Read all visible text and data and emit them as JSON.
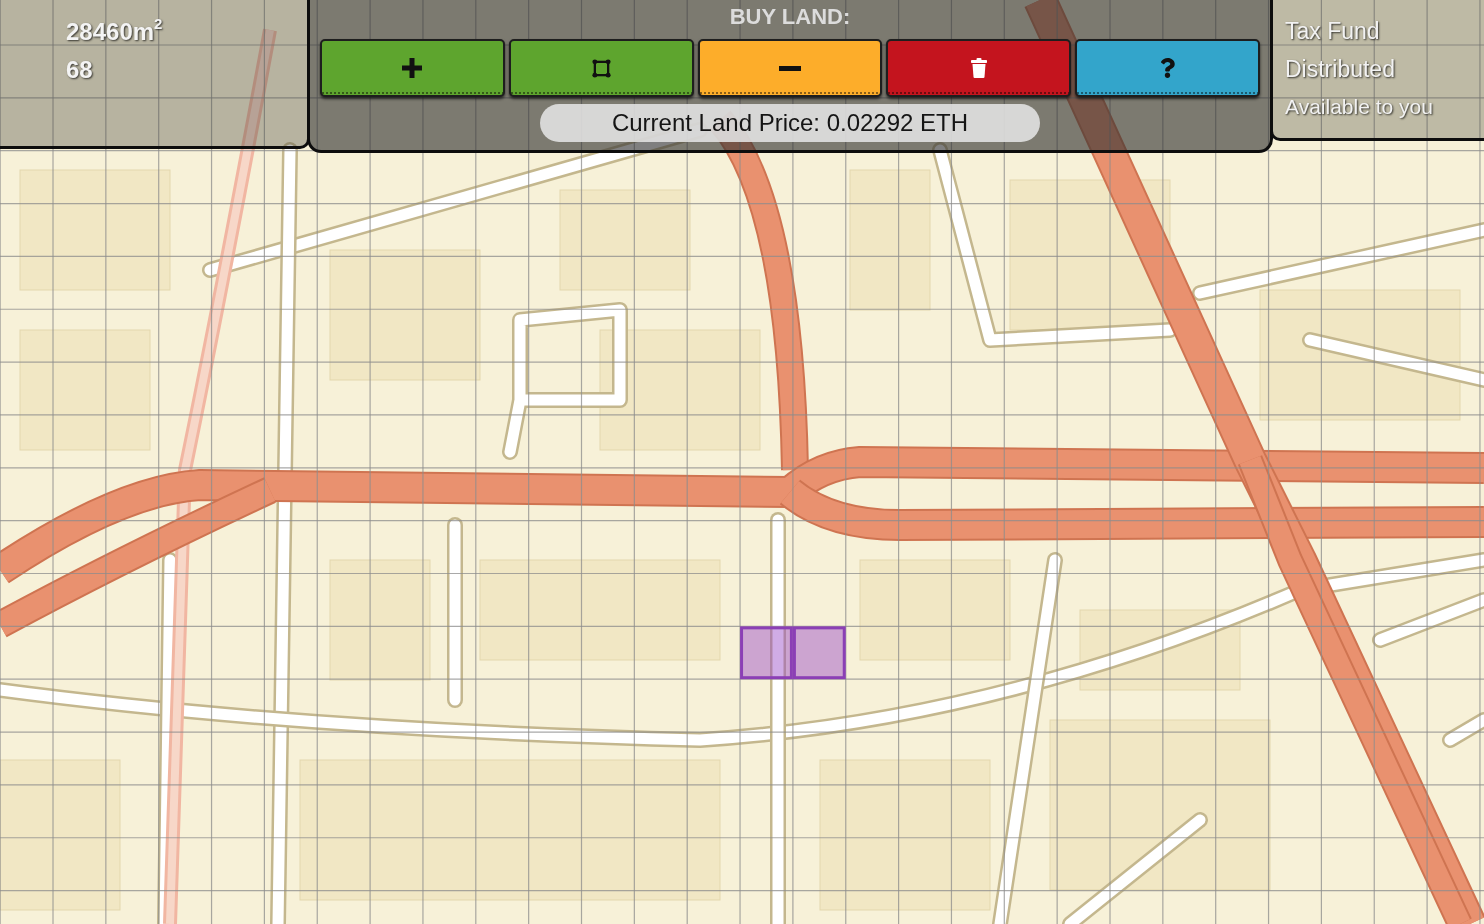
{
  "stats_panel": {
    "area": "28460m$^{2}$",
    "count": "68"
  },
  "buy_panel": {
    "title": "BUY LAND:",
    "buttons": [
      {
        "kind": "add",
        "color": "#5ea52e"
      },
      {
        "kind": "select",
        "color": "#5ea52e"
      },
      {
        "kind": "remove",
        "color": "#fdad2a"
      },
      {
        "kind": "delete",
        "color": "#c4141e"
      },
      {
        "kind": "help",
        "color": "#33a5cb"
      }
    ],
    "price": "Current Land Price: 0.02292 ETH"
  },
  "tax_panel": {
    "lines": [
      "Tax Fund",
      "Distributed",
      "Available to you"
    ]
  }
}
